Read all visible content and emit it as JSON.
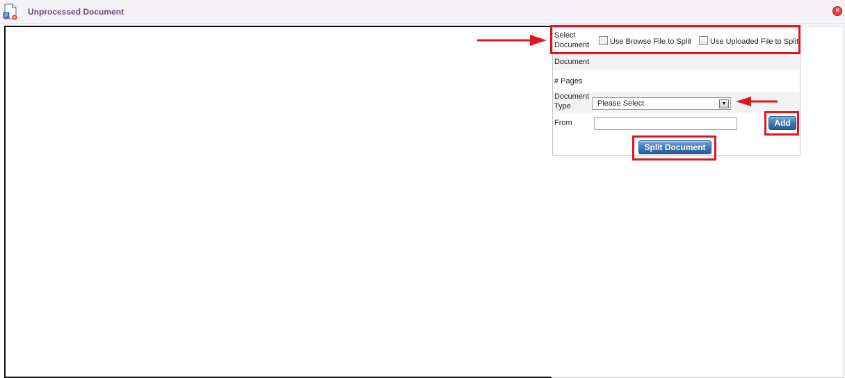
{
  "window": {
    "title": "Unprocessed Document",
    "close_symbol": "×",
    "icon": "document-icon",
    "close_icon": "close-icon",
    "accent_title_color": "#6b4a85",
    "close_color": "#e8413a"
  },
  "form": {
    "select_document_label": "Select Document",
    "option_browse_label": "Use Browse File to Split",
    "option_uploaded_label": "Use Uploaded File to Split",
    "option_browse_checked": false,
    "option_uploaded_checked": false,
    "document_label": "Document",
    "document_value": "",
    "pages_label": "# Pages",
    "pages_value": "",
    "document_type_label": "Document Type",
    "document_type_value": "Please Select",
    "from_label": "From",
    "from_value": "",
    "add_button": "Add",
    "split_button": "Split Document"
  },
  "annotations": {
    "highlight_color": "#e3141e",
    "arrow_color": "#e3141e"
  }
}
